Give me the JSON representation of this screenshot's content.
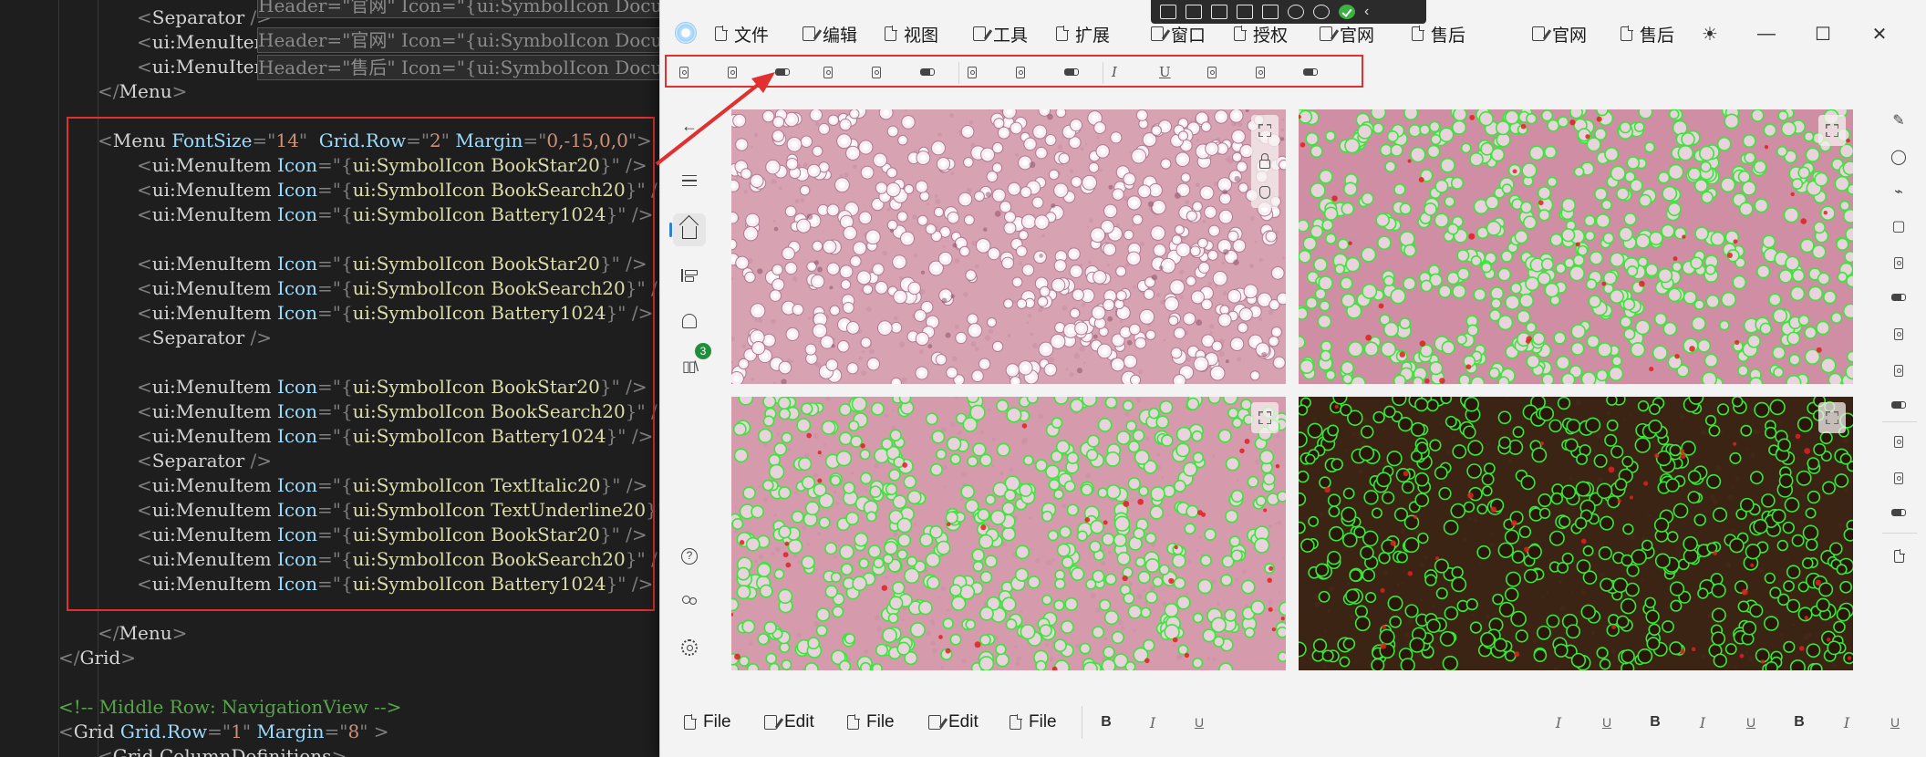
{
  "editor": {
    "lines": [
      {
        "parts": [
          [
            "brk",
            "<"
          ],
          [
            "tag",
            "Separator "
          ],
          [
            "brk",
            "/>"
          ]
        ]
      },
      {
        "parts": [
          [
            "brk",
            "<"
          ],
          [
            "tag",
            "ui:MenuItem"
          ]
        ]
      },
      {
        "parts": [
          [
            "brk",
            "<"
          ],
          [
            "tag",
            "ui:MenuItem"
          ]
        ]
      },
      {
        "parts": [
          [
            "brk",
            "</"
          ],
          [
            "tag",
            "Menu"
          ],
          [
            "brk",
            ">"
          ]
        ]
      },
      {
        "parts": []
      },
      {
        "parts": [
          [
            "brk",
            "<"
          ],
          [
            "tag",
            "Menu "
          ],
          [
            "attr",
            "FontSize"
          ],
          [
            "brk",
            "=\""
          ],
          [
            "val",
            "14"
          ],
          [
            "brk",
            "\"  "
          ],
          [
            "attr",
            "Grid.Row"
          ],
          [
            "brk",
            "=\""
          ],
          [
            "val",
            "2"
          ],
          [
            "brk",
            "\" "
          ],
          [
            "attr",
            "Margin"
          ],
          [
            "brk",
            "=\""
          ],
          [
            "val",
            "0,-15,0,0"
          ],
          [
            "brk",
            "\">"
          ]
        ]
      },
      {
        "parts": [
          [
            "brk",
            "<"
          ],
          [
            "tag",
            "ui:MenuItem "
          ],
          [
            "attr",
            "Icon"
          ],
          [
            "brk",
            "=\"{"
          ],
          [
            "key",
            "ui:SymbolIcon BookStar20"
          ],
          [
            "brk",
            "}\" />"
          ]
        ]
      },
      {
        "parts": [
          [
            "brk",
            "<"
          ],
          [
            "tag",
            "ui:MenuItem "
          ],
          [
            "attr",
            "Icon"
          ],
          [
            "brk",
            "=\"{"
          ],
          [
            "key",
            "ui:SymbolIcon BookSearch20"
          ],
          [
            "brk",
            "}\" />"
          ]
        ]
      },
      {
        "parts": [
          [
            "brk",
            "<"
          ],
          [
            "tag",
            "ui:MenuItem "
          ],
          [
            "attr",
            "Icon"
          ],
          [
            "brk",
            "=\"{"
          ],
          [
            "key",
            "ui:SymbolIcon Battery1024"
          ],
          [
            "brk",
            "}\" />"
          ]
        ]
      },
      {
        "parts": []
      },
      {
        "parts": [
          [
            "brk",
            "<"
          ],
          [
            "tag",
            "ui:MenuItem "
          ],
          [
            "attr",
            "Icon"
          ],
          [
            "brk",
            "=\"{"
          ],
          [
            "key",
            "ui:SymbolIcon BookStar20"
          ],
          [
            "brk",
            "}\" />"
          ]
        ]
      },
      {
        "parts": [
          [
            "brk",
            "<"
          ],
          [
            "tag",
            "ui:MenuItem "
          ],
          [
            "attr",
            "Icon"
          ],
          [
            "brk",
            "=\"{"
          ],
          [
            "key",
            "ui:SymbolIcon BookSearch20"
          ],
          [
            "brk",
            "}\" />"
          ]
        ]
      },
      {
        "parts": [
          [
            "brk",
            "<"
          ],
          [
            "tag",
            "ui:MenuItem "
          ],
          [
            "attr",
            "Icon"
          ],
          [
            "brk",
            "=\"{"
          ],
          [
            "key",
            "ui:SymbolIcon Battery1024"
          ],
          [
            "brk",
            "}\" />"
          ]
        ]
      },
      {
        "parts": [
          [
            "brk",
            "<"
          ],
          [
            "tag",
            "Separator "
          ],
          [
            "brk",
            "/>"
          ]
        ]
      },
      {
        "parts": []
      },
      {
        "parts": [
          [
            "brk",
            "<"
          ],
          [
            "tag",
            "ui:MenuItem "
          ],
          [
            "attr",
            "Icon"
          ],
          [
            "brk",
            "=\"{"
          ],
          [
            "key",
            "ui:SymbolIcon BookStar20"
          ],
          [
            "brk",
            "}\" />"
          ]
        ]
      },
      {
        "parts": [
          [
            "brk",
            "<"
          ],
          [
            "tag",
            "ui:MenuItem "
          ],
          [
            "attr",
            "Icon"
          ],
          [
            "brk",
            "=\"{"
          ],
          [
            "key",
            "ui:SymbolIcon BookSearch20"
          ],
          [
            "brk",
            "}\" />"
          ]
        ]
      },
      {
        "parts": [
          [
            "brk",
            "<"
          ],
          [
            "tag",
            "ui:MenuItem "
          ],
          [
            "attr",
            "Icon"
          ],
          [
            "brk",
            "=\"{"
          ],
          [
            "key",
            "ui:SymbolIcon Battery1024"
          ],
          [
            "brk",
            "}\" />"
          ]
        ]
      },
      {
        "parts": [
          [
            "brk",
            "<"
          ],
          [
            "tag",
            "Separator "
          ],
          [
            "brk",
            "/>"
          ]
        ]
      },
      {
        "parts": [
          [
            "brk",
            "<"
          ],
          [
            "tag",
            "ui:MenuItem "
          ],
          [
            "attr",
            "Icon"
          ],
          [
            "brk",
            "=\"{"
          ],
          [
            "key",
            "ui:SymbolIcon TextItalic20"
          ],
          [
            "brk",
            "}\" />"
          ]
        ]
      },
      {
        "parts": [
          [
            "brk",
            "<"
          ],
          [
            "tag",
            "ui:MenuItem "
          ],
          [
            "attr",
            "Icon"
          ],
          [
            "brk",
            "=\"{"
          ],
          [
            "key",
            "ui:SymbolIcon TextUnderline20"
          ],
          [
            "brk",
            "}\""
          ]
        ]
      },
      {
        "parts": [
          [
            "brk",
            "<"
          ],
          [
            "tag",
            "ui:MenuItem "
          ],
          [
            "attr",
            "Icon"
          ],
          [
            "brk",
            "=\"{"
          ],
          [
            "key",
            "ui:SymbolIcon BookStar20"
          ],
          [
            "brk",
            "}\" />"
          ]
        ]
      },
      {
        "parts": [
          [
            "brk",
            "<"
          ],
          [
            "tag",
            "ui:MenuItem "
          ],
          [
            "attr",
            "Icon"
          ],
          [
            "brk",
            "=\"{"
          ],
          [
            "key",
            "ui:SymbolIcon BookSearch20"
          ],
          [
            "brk",
            "}\" />"
          ]
        ]
      },
      {
        "parts": [
          [
            "brk",
            "<"
          ],
          [
            "tag",
            "ui:MenuItem "
          ],
          [
            "attr",
            "Icon"
          ],
          [
            "brk",
            "=\"{"
          ],
          [
            "key",
            "ui:SymbolIcon Battery1024"
          ],
          [
            "brk",
            "}\" />"
          ]
        ]
      },
      {
        "parts": []
      },
      {
        "parts": [
          [
            "brk",
            "</"
          ],
          [
            "tag",
            "Menu"
          ],
          [
            "brk",
            ">"
          ]
        ]
      },
      {
        "parts": [
          [
            "brk",
            "</"
          ],
          [
            "tag",
            "Grid"
          ],
          [
            "brk",
            ">"
          ]
        ]
      },
      {
        "parts": []
      },
      {
        "comment": "<!-- Middle Row: NavigationView -->"
      },
      {
        "parts": [
          [
            "brk",
            "<"
          ],
          [
            "tag",
            "Grid "
          ],
          [
            "attr",
            "Grid.Row"
          ],
          [
            "brk",
            "=\""
          ],
          [
            "val",
            "1"
          ],
          [
            "brk",
            "\" "
          ],
          [
            "attr",
            "Margin"
          ],
          [
            "brk",
            "=\""
          ],
          [
            "val",
            "8"
          ],
          [
            "brk",
            "\" >"
          ]
        ]
      },
      {
        "parts": [
          [
            "brk",
            "<"
          ],
          [
            "tag",
            "Grid.ColumnDefinitions"
          ],
          [
            "brk",
            ">"
          ]
        ]
      }
    ],
    "hints": [
      "Header=\"官网\" Icon=\"{ui:SymbolIcon Docu",
      "Header=\"售后\" Icon=\"{ui:SymbolIcon Docu"
    ]
  },
  "app": {
    "menu": [
      {
        "label": "文件",
        "icon": "document-icon"
      },
      {
        "label": "编辑",
        "icon": "edit-icon"
      },
      {
        "label": "视图",
        "icon": "view-icon"
      },
      {
        "label": "工具",
        "icon": "edit-icon"
      },
      {
        "label": "扩展",
        "icon": "document-icon"
      },
      {
        "label": "窗口",
        "icon": "edit-icon"
      },
      {
        "label": "授权",
        "icon": "document-icon"
      },
      {
        "label": "官网",
        "icon": "edit-icon"
      },
      {
        "label": "售后",
        "icon": "document-icon"
      },
      {
        "label": "官网",
        "icon": "edit-icon"
      },
      {
        "label": "售后",
        "icon": "document-icon"
      }
    ],
    "window_controls": {
      "theme": "☀",
      "minimize": "—",
      "maximize": "☐",
      "close": "✕"
    },
    "icon_strip": [
      "book-star-icon",
      "book-search-icon",
      "battery-icon",
      "book-star-icon",
      "book-search-icon",
      "battery-icon",
      "separator",
      "book-star-icon",
      "book-search-icon",
      "battery-icon",
      "separator",
      "text-italic-icon",
      "text-underline-icon",
      "book-star-icon",
      "book-search-icon",
      "battery-icon"
    ],
    "nav": {
      "items": [
        "back",
        "hamburger",
        "home",
        "library",
        "alerts",
        "collection",
        "help",
        "users",
        "settings"
      ],
      "badge": "3"
    },
    "bottom_bar": {
      "items": [
        {
          "label": "File",
          "icon": "document-icon"
        },
        {
          "label": "Edit",
          "icon": "edit-icon"
        },
        {
          "label": "File",
          "icon": "document-icon"
        },
        {
          "label": "Edit",
          "icon": "edit-icon"
        },
        {
          "label": "File",
          "icon": "document-icon"
        }
      ],
      "left_format": [
        "B",
        "I",
        "U"
      ],
      "right_format": [
        "I",
        "U",
        "B",
        "I",
        "U",
        "B",
        "I",
        "U"
      ]
    },
    "colors": {
      "accent": "#2f7fd1",
      "highlight": "#e03030",
      "detect_green": "#38e838",
      "detect_red": "#e02020",
      "tissue_pink": "#d7a3b3",
      "dark_bg": "#3b2414"
    }
  }
}
